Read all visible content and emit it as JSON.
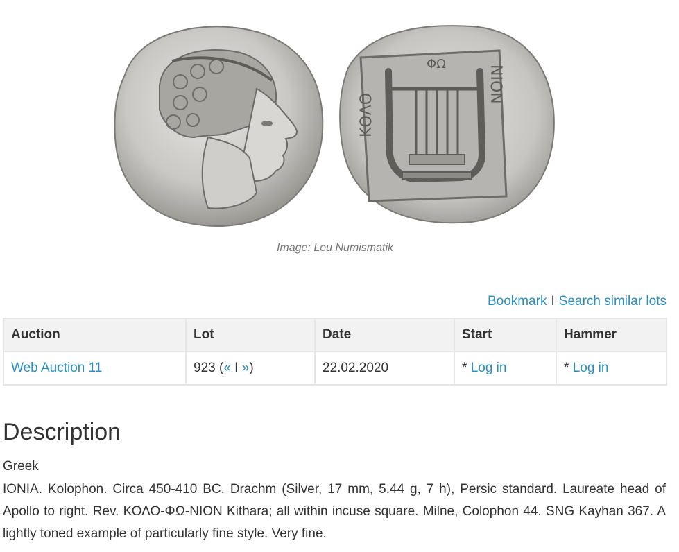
{
  "image": {
    "caption": "Image: Leu Numismatik",
    "obverse_icon": "apollo-head-coin-icon",
    "reverse_icon": "kithara-coin-icon",
    "reverse_legend_left": "ΚΟΛΟ",
    "reverse_legend_top": "ΦΩ",
    "reverse_legend_right": "ΝΙΟΝ"
  },
  "actions": {
    "bookmark": "Bookmark",
    "separator": "I",
    "search_similar": "Search similar lots"
  },
  "table": {
    "headers": [
      "Auction",
      "Lot",
      "Date",
      "Start",
      "Hammer"
    ],
    "row": {
      "auction": "Web Auction 11",
      "lot_number": "923",
      "prev": "«",
      "nav_sep": "I",
      "next": "»",
      "date": "22.02.2020",
      "start_prefix": "*",
      "start_link": "Log in",
      "hammer_prefix": "*",
      "hammer_link": "Log in"
    }
  },
  "description": {
    "heading": "Description",
    "category": "Greek",
    "text": "IONIA. Kolophon. Circa 450-410 BC. Drachm (Silver, 17 mm, 5.44 g, 7 h), Persic standard. Laureate head of Apollo to right. Rev. ΚΟΛΟ-ΦΩ-ΝΙΟΝ Kithara; all within incuse square. Milne, Colophon 44. SNG Kayhan 367. A lightly toned example of particularly fine style. Very fine."
  },
  "colors": {
    "link": "#2a8fc1",
    "text": "#333333",
    "header_bg": "#f2f2f2",
    "border": "#e6e6e6"
  }
}
